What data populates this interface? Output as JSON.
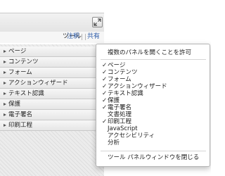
{
  "toolbar": {
    "tools_label": "ツール",
    "comment_label": "注釈",
    "share_label": "共有"
  },
  "panels": [
    {
      "label": "ページ"
    },
    {
      "label": "コンテンツ"
    },
    {
      "label": "フォーム"
    },
    {
      "label": "アクションウィザード"
    },
    {
      "label": "テキスト認識"
    },
    {
      "label": "保護"
    },
    {
      "label": "電子署名"
    },
    {
      "label": "印刷工程"
    }
  ],
  "menu": {
    "allow_multiple": "複数のパネルを開くことを許可",
    "items": [
      {
        "label": "ページ",
        "check": "✓"
      },
      {
        "label": "コンテンツ",
        "check": "✓"
      },
      {
        "label": "フォーム",
        "check": "✓"
      },
      {
        "label": "アクションウィザード",
        "check": "✓"
      },
      {
        "label": "テキスト認識",
        "check": "✓"
      },
      {
        "label": "保護",
        "check": "✓"
      },
      {
        "label": "電子署名",
        "check": "✓"
      },
      {
        "label": "文書処理",
        "check": ""
      },
      {
        "label": "印刷工程",
        "check": "✓"
      },
      {
        "label": "JavaScript",
        "check": ""
      },
      {
        "label": "アクセシビリティ",
        "check": ""
      },
      {
        "label": "分析",
        "check": ""
      }
    ],
    "close_label": "ツール パネルウィンドウを閉じる"
  }
}
